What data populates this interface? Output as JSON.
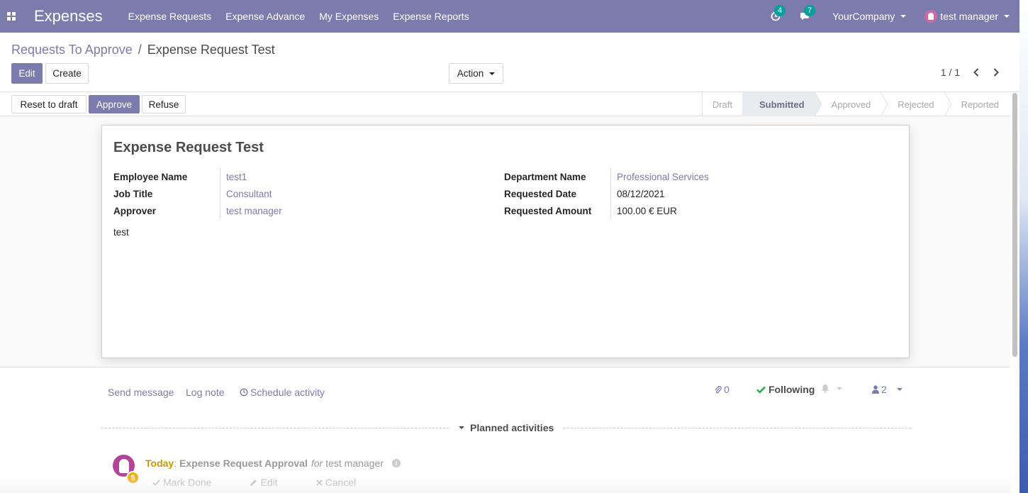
{
  "navbar": {
    "app_name": "Expenses",
    "menu": [
      "Expense Requests",
      "Expense Advance",
      "My Expenses",
      "Expense Reports"
    ],
    "activity_count": "4",
    "message_count": "7",
    "company": "YourCompany",
    "user": "test manager",
    "color": "#7c7bad"
  },
  "breadcrumb": {
    "parent": "Requests To Approve",
    "separator": "/",
    "current": "Expense Request Test"
  },
  "buttons": {
    "edit": "Edit",
    "create": "Create",
    "action": "Action",
    "reset_to_draft": "Reset to draft",
    "approve": "Approve",
    "refuse": "Refuse"
  },
  "pager": {
    "value": "1 / 1"
  },
  "stages": [
    {
      "label": "Draft",
      "active": false
    },
    {
      "label": "Submitted",
      "active": true
    },
    {
      "label": "Approved",
      "active": false
    },
    {
      "label": "Rejected",
      "active": false
    },
    {
      "label": "Reported",
      "active": false
    }
  ],
  "form": {
    "title": "Expense Request Test",
    "left_fields": [
      {
        "label": "Employee Name",
        "value": "test1",
        "link": true
      },
      {
        "label": "Job Title",
        "value": "Consultant",
        "link": true
      },
      {
        "label": "Approver",
        "value": "test manager",
        "link": true
      }
    ],
    "right_fields": [
      {
        "label": "Department Name",
        "value": "Professional Services",
        "link": true
      },
      {
        "label": "Requested Date",
        "value": "08/12/2021",
        "link": false
      },
      {
        "label": "Requested Amount",
        "value": "100.00 € EUR",
        "link": false
      }
    ],
    "description": "test"
  },
  "chatter": {
    "send_message": "Send message",
    "log_note": "Log note",
    "schedule_activity": "Schedule activity",
    "attachments": "0",
    "following": "Following",
    "followers": "2",
    "planned_activities": "Planned activities"
  },
  "activity": {
    "when": "Today",
    "separator": ":",
    "title": "Expense Request Approval",
    "for": "for",
    "user": "test manager",
    "mark_done": "Mark Done",
    "edit": "Edit",
    "cancel": "Cancel",
    "badge": "$"
  }
}
